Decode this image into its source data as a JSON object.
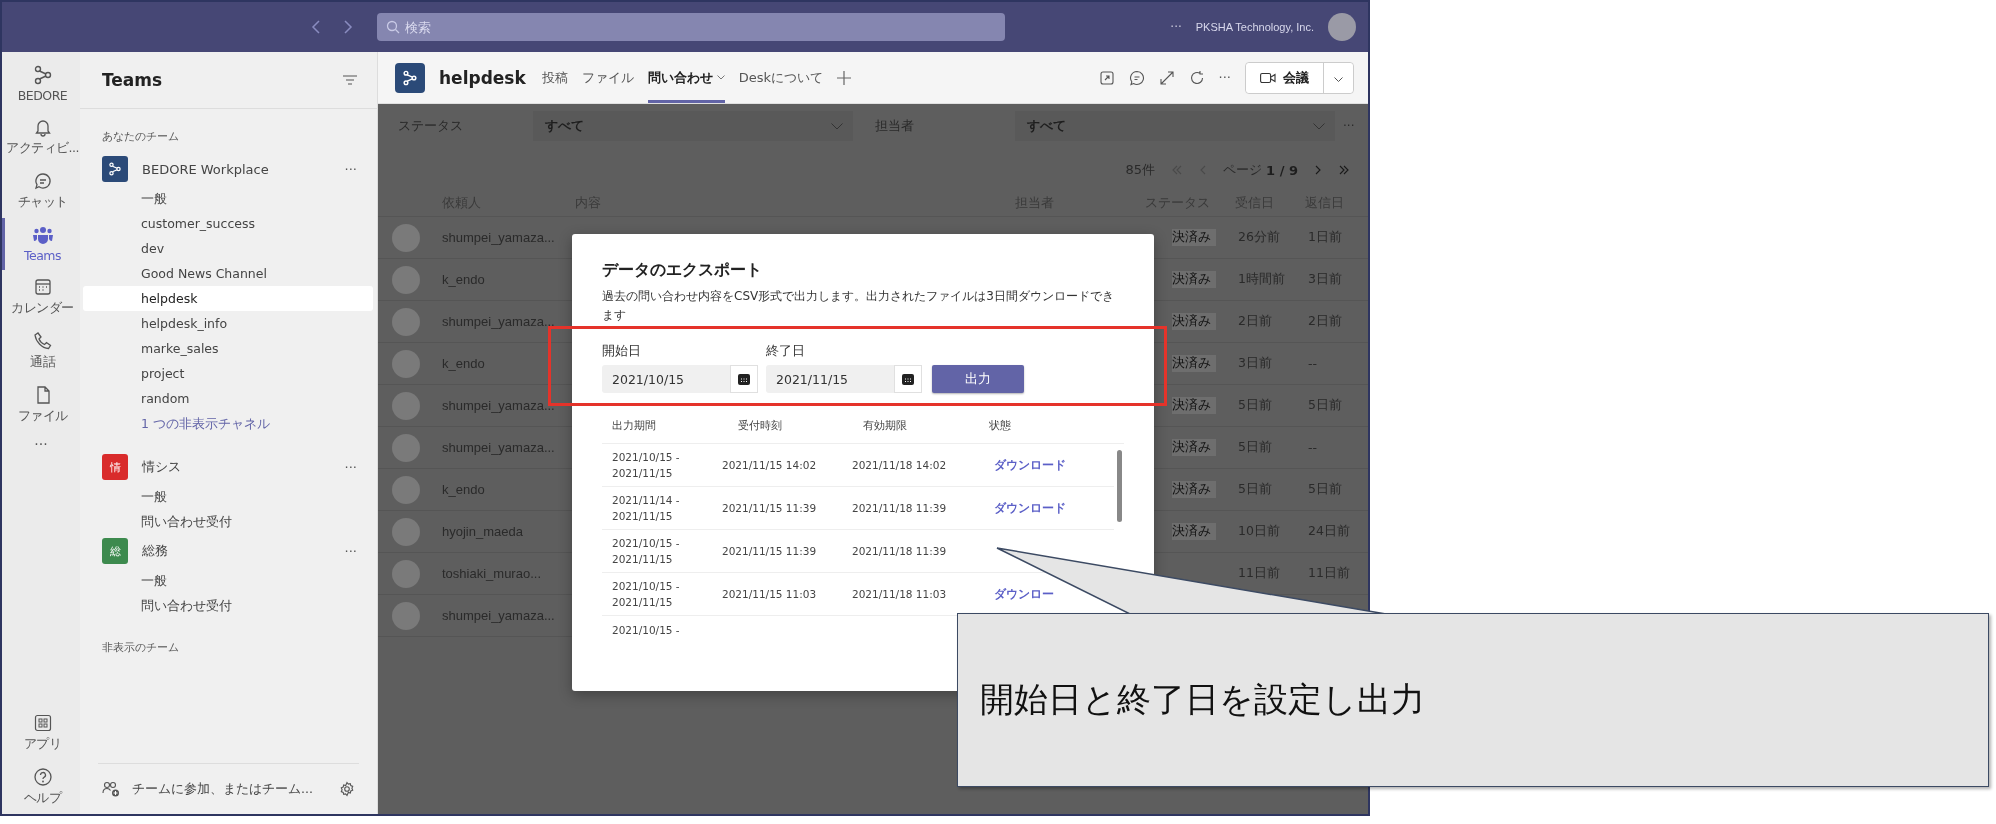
{
  "top_bar": {
    "search": {
      "placeholder": "検索"
    },
    "more": "···",
    "org": "PKSHA Technology, Inc."
  },
  "rail": {
    "items": [
      {
        "label": "BEDORE",
        "kind": "logo",
        "selected": false
      },
      {
        "label": "アクティビ...",
        "kind": "bell",
        "selected": false
      },
      {
        "label": "チャット",
        "kind": "chat",
        "selected": false
      },
      {
        "label": "Teams",
        "kind": "teams",
        "selected": true
      },
      {
        "label": "カレンダー",
        "kind": "calendar",
        "selected": false
      },
      {
        "label": "通話",
        "kind": "phone",
        "selected": false
      },
      {
        "label": "ファイル",
        "kind": "file",
        "selected": false
      }
    ],
    "more": "···",
    "bottom": [
      {
        "label": "アプリ",
        "kind": "apps",
        "selected": false
      },
      {
        "label": "ヘルプ",
        "kind": "help",
        "selected": false
      }
    ]
  },
  "sidebar": {
    "title": "Teams",
    "section": "あなたのチーム",
    "teams": [
      {
        "name": "BEDORE Workplace",
        "color": "#2b4a78",
        "more": "···",
        "channels": [
          {
            "name": "一般",
            "selected": false
          },
          {
            "name": "customer_success",
            "selected": false
          },
          {
            "name": "dev",
            "selected": false
          },
          {
            "name": "Good News Channel",
            "selected": false
          },
          {
            "name": "helpdesk",
            "selected": true
          },
          {
            "name": "helpdesk_info",
            "selected": false
          },
          {
            "name": "marke_sales",
            "selected": false
          },
          {
            "name": "project",
            "selected": false
          },
          {
            "name": "random",
            "selected": false
          }
        ],
        "hidden_link": "1 つの非表示チャネル"
      },
      {
        "name": "情シス",
        "badge": "情",
        "color": "#d92b2b",
        "more": "···",
        "channels": [
          {
            "name": "一般",
            "selected": false
          },
          {
            "name": "問い合わせ受付",
            "selected": false
          }
        ]
      },
      {
        "name": "総務",
        "badge": "総",
        "color": "#3d8a4e",
        "more": "···",
        "channels": [
          {
            "name": "一般",
            "selected": false
          },
          {
            "name": "問い合わせ受付",
            "selected": false
          }
        ]
      }
    ],
    "hidden_section": "非表示のチーム",
    "footer": "チームに参加、またはチーム..."
  },
  "header": {
    "title": "helpdesk",
    "tabs": [
      {
        "label": "投稿",
        "selected": false,
        "dropdown": false
      },
      {
        "label": "ファイル",
        "selected": false,
        "dropdown": false
      },
      {
        "label": "問い合わせ",
        "selected": true,
        "dropdown": true
      },
      {
        "label": "Deskについて",
        "selected": false,
        "dropdown": false
      }
    ],
    "more": "···",
    "meeting_button": "会議"
  },
  "filters": {
    "status_label": "ステータス",
    "status_value": "すべて",
    "assignee_label": "担当者",
    "assignee_value": "すべて",
    "more": "···"
  },
  "pagination": {
    "count": "85件",
    "page_label": "ページ",
    "page": "1 / 9"
  },
  "table": {
    "columns": [
      "依頼人",
      "内容",
      "担当者",
      "ステータス",
      "受信日",
      "返信日"
    ],
    "rows": [
      {
        "requester": "shumpei_yamaza...",
        "status": "決済み",
        "received": "26分前",
        "replied": "1日前"
      },
      {
        "requester": "k_endo",
        "status": "決済み",
        "received": "1時間前",
        "replied": "3日前"
      },
      {
        "requester": "shumpei_yamaza...",
        "status": "決済み",
        "received": "2日前",
        "replied": "2日前"
      },
      {
        "requester": "k_endo",
        "status": "決済み",
        "received": "3日前",
        "replied": "--"
      },
      {
        "requester": "shumpei_yamaza...",
        "status": "決済み",
        "received": "5日前",
        "replied": "5日前"
      },
      {
        "requester": "shumpei_yamaza...",
        "status": "決済み",
        "received": "5日前",
        "replied": "--"
      },
      {
        "requester": "k_endo",
        "status": "決済み",
        "received": "5日前",
        "replied": "5日前"
      },
      {
        "requester": "hyojin_maeda",
        "status": "決済み",
        "received": "10日前",
        "replied": "24日前"
      },
      {
        "requester": "toshiaki_murao...",
        "received": "11日前",
        "replied": "11日前"
      },
      {
        "requester": "shumpei_yamaza..."
      }
    ]
  },
  "export_dialog": {
    "title": "データのエクスポート",
    "description": "過去の問い合わせ内容をCSV形式で出力します。出力されたファイルは3日間ダウンロードできます",
    "start_label": "開始日",
    "start_value": "2021/10/15",
    "end_label": "終了日",
    "end_value": "2021/11/15",
    "submit": "出力",
    "columns": [
      "出力期間",
      "受付時刻",
      "有効期限",
      "状態"
    ],
    "rows": [
      {
        "period": "2021/10/15 -\n2021/11/15",
        "received": "2021/11/15 14:02",
        "expires": "2021/11/18 14:02",
        "status": "ダウンロード"
      },
      {
        "period": "2021/11/14 -\n2021/11/15",
        "received": "2021/11/15 11:39",
        "expires": "2021/11/18 11:39",
        "status": "ダウンロード"
      },
      {
        "period": "2021/10/15 -\n2021/11/15",
        "received": "2021/11/15 11:39",
        "expires": "2021/11/18 11:39"
      },
      {
        "period": "2021/10/15 -\n2021/11/15",
        "received": "2021/11/15 11:03",
        "expires": "2021/11/18 11:03",
        "status": "ダウンロー"
      },
      {
        "period": "2021/10/15 -"
      }
    ]
  },
  "callout": {
    "text": "開始日と終了日を設定し出力"
  }
}
